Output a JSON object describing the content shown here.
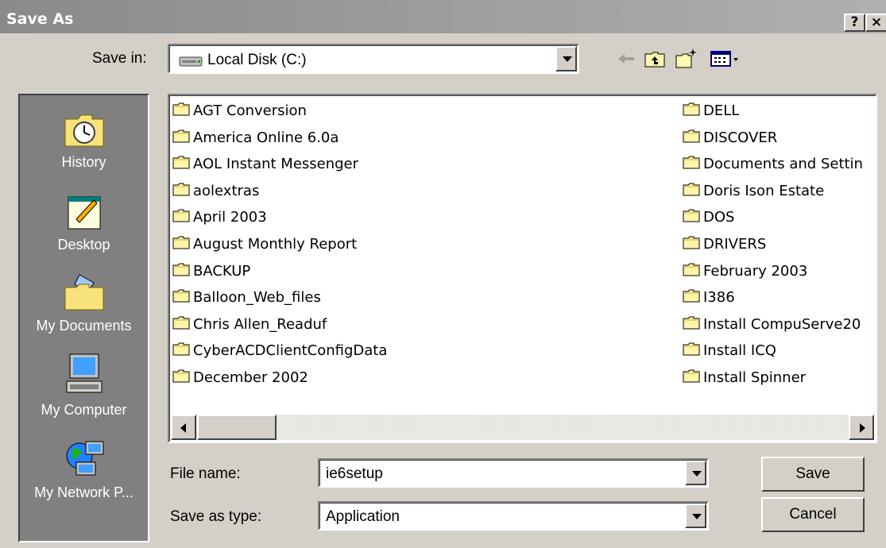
{
  "window": {
    "title": "Save As",
    "help_label": "?",
    "close_label": "×"
  },
  "save_in": {
    "label": "Save in:",
    "value": "Local Disk (C:)"
  },
  "places": [
    {
      "label": "History",
      "icon": "history-icon"
    },
    {
      "label": "Desktop",
      "icon": "desktop-icon"
    },
    {
      "label": "My Documents",
      "icon": "my-documents-icon"
    },
    {
      "label": "My Computer",
      "icon": "my-computer-icon"
    },
    {
      "label": "My Network P...",
      "icon": "network-places-icon"
    }
  ],
  "files_col1": [
    "AGT Conversion",
    "America Online 6.0a",
    "AOL Instant Messenger",
    "aolextras",
    "April 2003",
    "August Monthly Report",
    "BACKUP",
    "Balloon_Web_files",
    "Chris Allen_Readuf",
    "CyberACDClientConfigData",
    "December 2002"
  ],
  "files_col2": [
    "DELL",
    "DISCOVER",
    "Documents and Settin",
    "Doris Ison Estate",
    "DOS",
    "DRIVERS",
    "February 2003",
    "I386",
    "Install CompuServe20",
    "Install ICQ",
    "Install Spinner"
  ],
  "file_name": {
    "label": "File name:",
    "value": "ie6setup"
  },
  "save_as_type": {
    "label": "Save as type:",
    "value": "Application"
  },
  "buttons": {
    "save": "Save",
    "cancel": "Cancel"
  }
}
